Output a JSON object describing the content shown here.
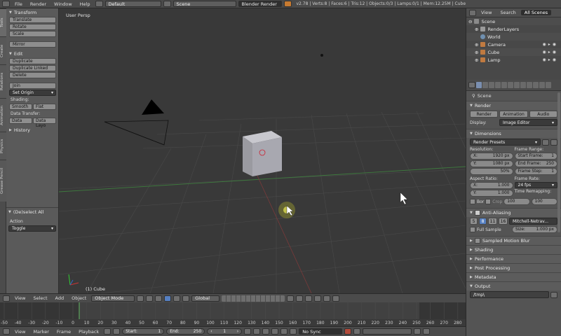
{
  "topbar": {
    "menus": [
      "File",
      "Render",
      "Window",
      "Help"
    ],
    "layout": "Default",
    "scene": "Scene",
    "engine": "Blender Render",
    "stats": "v2.78 | Verts:8 | Faces:6 | Tris:12 | Objects:0/3 | Lamps:0/1 | Mem:12.25M | Cube"
  },
  "shelf": {
    "tabs": [
      "Tools",
      "Create",
      "Relations",
      "Animation",
      "Physics",
      "Grease Pencil"
    ],
    "transform": {
      "title": "Transform",
      "buttons": [
        "Translate",
        "Rotate",
        "Scale"
      ],
      "mirror": "Mirror"
    },
    "edit": {
      "title": "Edit",
      "buttons": [
        "Duplicate",
        "Duplicate Linked",
        "Delete"
      ],
      "join": "Join",
      "set_origin": "Set Origin",
      "shading_label": "Shading:",
      "smooth": "Smooth",
      "flat": "Flat",
      "data_transfer_label": "Data Transfer:",
      "data": "Data",
      "data_layout": "Data Layo"
    },
    "history": "History",
    "operator": {
      "title": "(De)select All",
      "action_label": "Action",
      "action_value": "Toggle"
    }
  },
  "viewport": {
    "label": "User Persp",
    "object": "(1) Cube"
  },
  "viewheader": {
    "items": [
      "View",
      "Select",
      "Add",
      "Object"
    ],
    "mode": "Object Mode",
    "orientation": "Global"
  },
  "timeline": {
    "ticks": [
      "-50",
      "-40",
      "-30",
      "-20",
      "-10",
      "0",
      "10",
      "20",
      "30",
      "40",
      "50",
      "60",
      "70",
      "80",
      "90",
      "100",
      "110",
      "120",
      "130",
      "140",
      "150",
      "160",
      "170",
      "180",
      "190",
      "200",
      "210",
      "220",
      "230",
      "240",
      "250",
      "260",
      "270",
      "280"
    ],
    "header_items": [
      "View",
      "Marker",
      "Frame",
      "Playback"
    ],
    "start_label": "Start:",
    "start_value": "1",
    "end_label": "End:",
    "end_value": "250",
    "current_frame": "1",
    "sync": "No Sync"
  },
  "outliner": {
    "tabs": [
      "View",
      "Search",
      "All Scenes"
    ],
    "rows": [
      "Scene",
      "RenderLayers",
      "World",
      "Camera",
      "Cube",
      "Lamp"
    ]
  },
  "props": {
    "scene": "Scene",
    "render": {
      "title": "Render",
      "render_btn": "Render",
      "animation_btn": "Animation",
      "audio_btn": "Audio",
      "display_label": "Display:",
      "display_value": "Image Editor"
    },
    "dimensions": {
      "title": "Dimensions",
      "presets": "Render Presets",
      "resolution_label": "Resolution:",
      "x": "X:",
      "x_val": "1920 px",
      "y": "Y:",
      "y_val": "1080 px",
      "pct": "50%",
      "frame_range_label": "Frame Range:",
      "start": "Start Frame:",
      "start_val": "1",
      "end": "End Frame:",
      "end_val": "250",
      "step": "Frame Step:",
      "step_val": "1",
      "aspect_label": "Aspect Ratio:",
      "ax_val": "1.000",
      "ay_val": "1.000",
      "frame_rate_label": "Frame Rate:",
      "fps": "24 fps",
      "time_remap_label": "Time Remapping:",
      "remap_old": "100",
      "remap_new": "100",
      "border": "Bor",
      "crop": "Crop"
    },
    "aa": {
      "title": "Anti-Aliasing",
      "samples": [
        "5",
        "8",
        "11",
        "16"
      ],
      "filter": "Mitchell-Netrav...",
      "full_sample": "Full Sample",
      "size_label": "Size:",
      "size_value": "1.000 px"
    },
    "sections": [
      "Sampled Motion Blur",
      "Shading",
      "Performance",
      "Post Processing",
      "Metadata",
      "Output"
    ],
    "output_path": "/tmp\\"
  },
  "colors": {
    "accent": "#5680c2",
    "viewport_bg": "#393939",
    "panel_bg": "#5a5a5a"
  }
}
